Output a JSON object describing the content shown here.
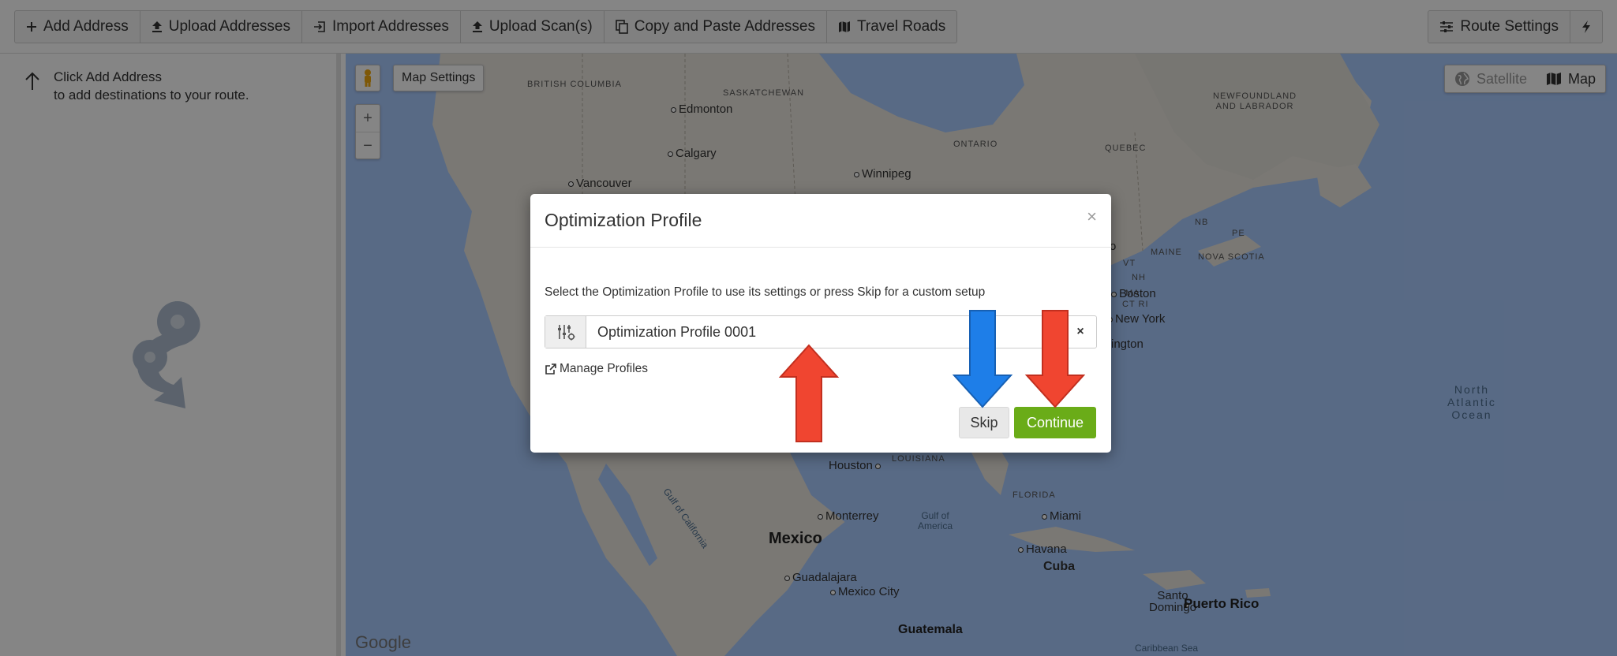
{
  "toolbar": {
    "left_buttons": [
      {
        "label": "Add Address",
        "icon": "plus-icon"
      },
      {
        "label": "Upload Addresses",
        "icon": "upload-icon"
      },
      {
        "label": "Import Addresses",
        "icon": "import-icon"
      },
      {
        "label": "Upload Scan(s)",
        "icon": "upload-icon"
      },
      {
        "label": "Copy and Paste Addresses",
        "icon": "copy-icon"
      },
      {
        "label": "Travel Roads",
        "icon": "map-icon"
      }
    ],
    "route_settings_label": "Route Settings",
    "route_settings_icon": "sliders-icon",
    "quick_icon": "lightning-icon"
  },
  "sidebar": {
    "hint_line1": "Click Add Address",
    "hint_line2": "to add destinations to your route.",
    "hint_icon": "arrow-up-icon"
  },
  "map": {
    "settings_label": "Map Settings",
    "zoom_in": "+",
    "zoom_out": "−",
    "type_satellite": "Satellite",
    "type_map": "Map",
    "attribution": "Google",
    "labels": {
      "british_columbia": "BRITISH\nCOLUMBIA",
      "saskatchewan": "SASKATCHEWAN",
      "newfoundland": "NEWFOUNDLAND\nAND LABRADOR",
      "ontario": "ONTARIO",
      "quebec": "QUEBEC",
      "nb": "NB",
      "pe": "PE",
      "maine": "MAINE",
      "nova_scotia": "NOVA SCOTIA",
      "vt": "VT",
      "nh": "NH",
      "ma": "MA",
      "ct": "CT RI",
      "louisiana": "LOUISIANA",
      "florida": "FLORIDA",
      "gulf_ca": "Gulf of California",
      "gulf_america": "Gulf of\nAmerica",
      "north_atlantic": "North\nAtlantic\nOcean",
      "caribbean": "Caribbean Sea",
      "edmonton": "Edmonton",
      "calgary": "Calgary",
      "vancouver": "Vancouver",
      "winnipeg": "Winnipeg",
      "boston": "Boston",
      "new_york": "New York",
      "ington": "ington",
      "houston": "Houston",
      "monterrey": "Monterrey",
      "miami": "Miami",
      "havana": "Havana",
      "cuba": "Cuba",
      "mexico": "Mexico",
      "guadalajara": "Guadalajara",
      "mexico_city": "Mexico City",
      "santo_domingo": "Santo\nDomingo",
      "puerto_rico": "Puerto Rico",
      "guatemala": "Guatemala",
      "o": "o"
    }
  },
  "modal": {
    "title": "Optimization Profile",
    "close": "×",
    "description": "Select the Optimization Profile to use its settings or press Skip for a custom setup",
    "selected_profile": "Optimization Profile 0001",
    "clear": "×",
    "manage_label": "Manage Profiles",
    "skip_label": "Skip",
    "continue_label": "Continue"
  },
  "colors": {
    "continue_green": "#6aac18",
    "arrow_red": "#f04530",
    "arrow_blue": "#1e7ee8",
    "ocean": "#aacbff",
    "land": "#eae6df"
  }
}
